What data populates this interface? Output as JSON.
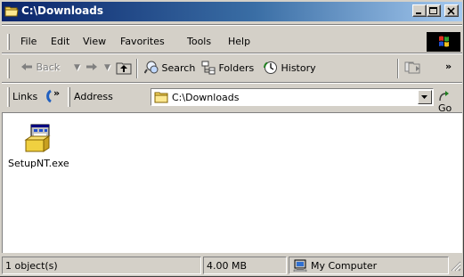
{
  "window": {
    "title": "C:\\Downloads",
    "controls": [
      "minimize",
      "maximize",
      "close"
    ]
  },
  "menu": {
    "items": [
      {
        "label": "File"
      },
      {
        "label": "Edit"
      },
      {
        "label": "View"
      },
      {
        "label": "Favorites"
      },
      {
        "label": "Tools"
      },
      {
        "label": "Help"
      }
    ]
  },
  "toolbar": {
    "back_label": "Back",
    "search_label": "Search",
    "folders_label": "Folders",
    "history_label": "History",
    "more_label": "»"
  },
  "addressbar": {
    "links_label": "Links",
    "links_more": "»",
    "address_label": "Address",
    "address_value": "C:\\Downloads",
    "go_label": "Go"
  },
  "content": {
    "files": [
      {
        "name": "SetupNT.exe",
        "icon": "installer-icon"
      }
    ]
  },
  "statusbar": {
    "objects": "1 object(s)",
    "size": "4.00 MB",
    "zone": "My Computer"
  },
  "colors": {
    "titlebar_start": "#0a246a",
    "titlebar_end": "#a6caf0",
    "face": "#d4d0c8",
    "folder_yellow": "#f8d860"
  }
}
